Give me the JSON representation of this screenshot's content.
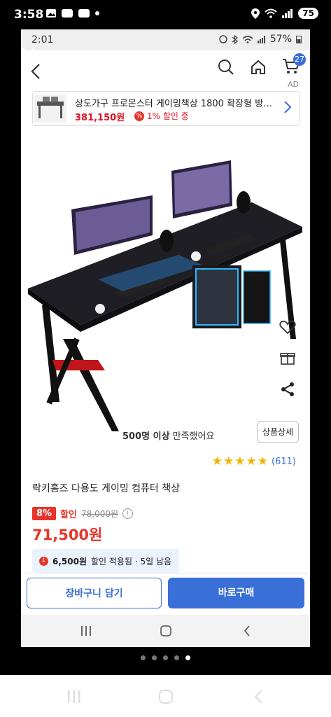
{
  "outer_status": {
    "time": "3:58",
    "battery": "75"
  },
  "inner_status": {
    "time": "2:01",
    "battery": "57%"
  },
  "topbar": {
    "cart_count": "27"
  },
  "ad": {
    "label": "AD",
    "title": "상도가구 프로몬스터 게이밍책상 1800 확장형 방문...",
    "price": "381,150원",
    "discount": "1% 할인 중"
  },
  "product": {
    "satisfaction_count": "500명 이상",
    "satisfaction_text": " 만족했어요",
    "detail_button": "상품상세",
    "rating": 5,
    "review_count": "(611)",
    "title": "락키홈즈 다용도 게이밍 컴퓨터 책상",
    "discount_pct": "8%",
    "discount_label": "할인",
    "original_price": "78,000원",
    "price": "71,500원",
    "coupon_amount": "6,500원",
    "coupon_text": "할인 적용됨 · 5일 남음"
  },
  "actions": {
    "cart": "장바구니 담기",
    "buy": "바로구매"
  },
  "colors": {
    "accent": "#3a6fd8",
    "sale": "#e8352a",
    "star": "#f5b301"
  },
  "pager": {
    "count": 5,
    "active": 4
  }
}
